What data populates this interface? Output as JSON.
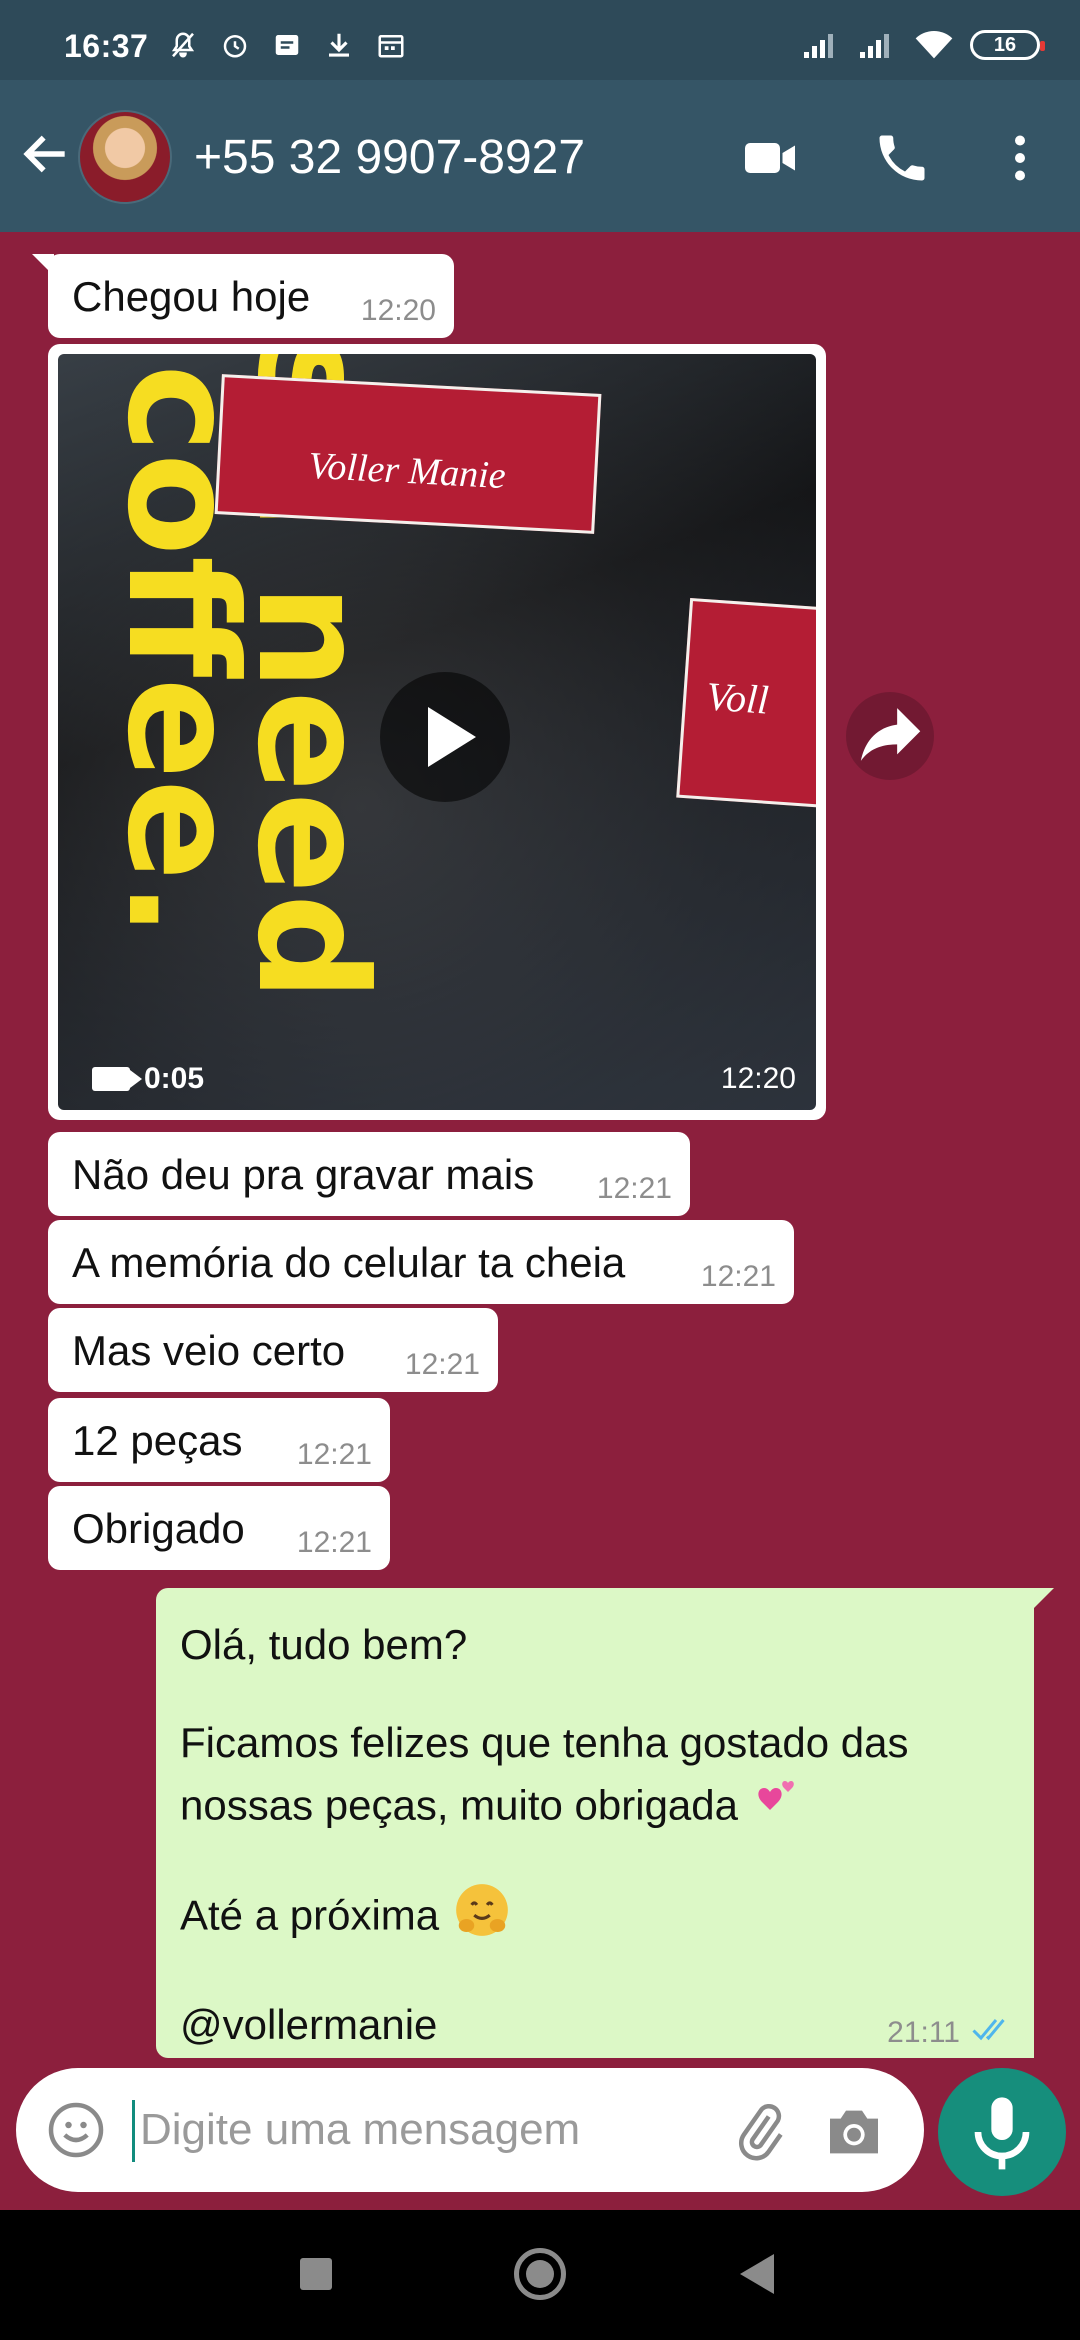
{
  "status_bar": {
    "time": "16:37",
    "battery": "16",
    "icons": [
      "mute-icon",
      "alarm-icon",
      "message-icon",
      "download-icon",
      "calendar-icon",
      "signal-icon",
      "signal-icon",
      "wifi-icon",
      "battery-icon"
    ]
  },
  "header": {
    "contact_name": "+55 32 9907-8927",
    "actions": [
      "video-call-icon",
      "voice-call-icon",
      "more-options-icon"
    ],
    "colors": {
      "bar": "#355566",
      "status": "#2e4a59"
    }
  },
  "chat": {
    "background": "#8c1f3d",
    "messages_in": [
      {
        "text": "Chegou hoje",
        "time": "12:20"
      },
      {
        "text": "Não deu pra gravar mais",
        "time": "12:21"
      },
      {
        "text": "A memória do celular ta cheia",
        "time": "12:21"
      },
      {
        "text": "Mas veio certo",
        "time": "12:21"
      },
      {
        "text": "12 peças",
        "time": "12:21"
      },
      {
        "text": "Obrigado",
        "time": "12:21"
      }
    ],
    "video": {
      "duration": "0:05",
      "time": "12:20",
      "tag_text_1": "Voller Manie",
      "tag_text_2": "Voll",
      "shirt_text": [
        "s I need",
        "coffee."
      ]
    },
    "message_out": {
      "lines": [
        "Olá, tudo bem?",
        "Ficamos felizes que tenha gostado das",
        "nossas peças, muito obrigada",
        "Até a próxima",
        "@vollermanie"
      ],
      "time": "21:11",
      "status": "read"
    }
  },
  "composer": {
    "placeholder": "Digite uma mensagem"
  },
  "nav": {
    "buttons": [
      "recents-button",
      "home-button",
      "back-button"
    ]
  }
}
